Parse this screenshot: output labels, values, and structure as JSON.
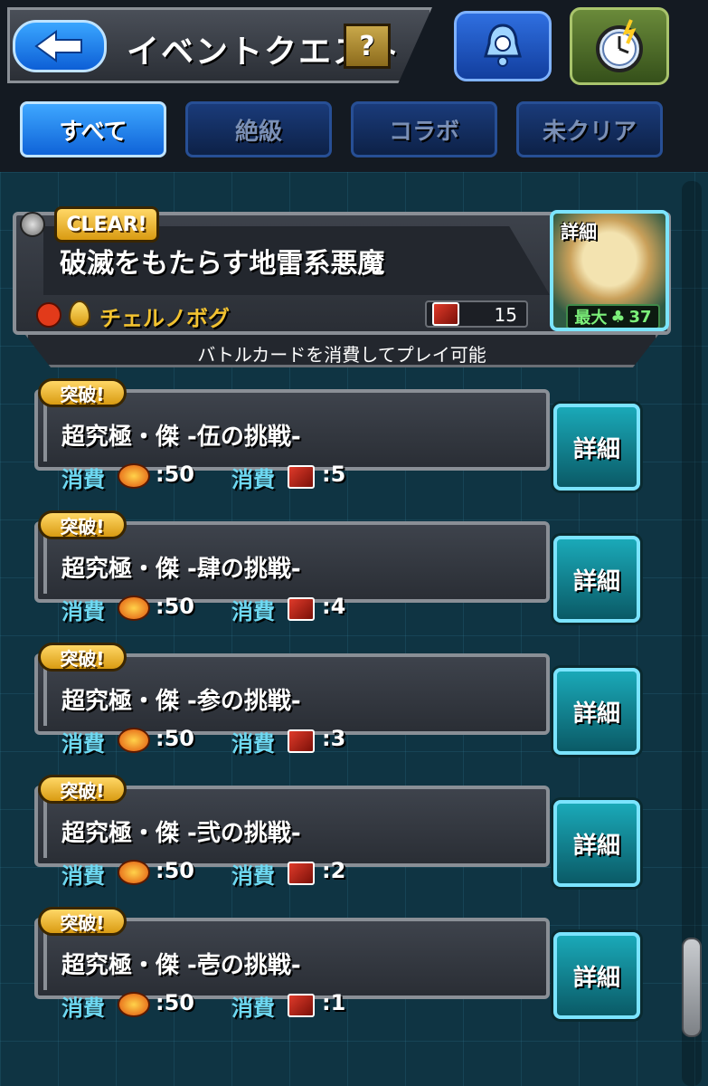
{
  "header": {
    "title": "イベントクエスト",
    "help_label": "?",
    "icons": [
      "back-arrow-icon",
      "bell-icon",
      "alarm-clock-icon"
    ]
  },
  "tabs": [
    {
      "label": "すべて",
      "active": true
    },
    {
      "label": "絶級",
      "active": false
    },
    {
      "label": "コラボ",
      "active": false
    },
    {
      "label": "未クリア",
      "active": false
    }
  ],
  "event": {
    "badge": "CLEAR!",
    "title": "破滅をもたらす地雷系悪魔",
    "boss_name": "チェルノボグ",
    "card_count": "15",
    "note": "バトルカードを消費してプレイ可能",
    "detail_label": "詳細",
    "max_label": "最大",
    "max_value": "37"
  },
  "quest_common": {
    "badge": "突破!",
    "cost_label": "消費",
    "stamina_value": ":50",
    "detail_label": "詳細"
  },
  "quests": [
    {
      "title": "超究極・傑 -伍の挑戦-",
      "card_cost": ":5"
    },
    {
      "title": "超究極・傑 -肆の挑戦-",
      "card_cost": ":4"
    },
    {
      "title": "超究極・傑 -参の挑戦-",
      "card_cost": ":3"
    },
    {
      "title": "超究極・傑 -弐の挑戦-",
      "card_cost": ":2"
    },
    {
      "title": "超究極・傑 -壱の挑戦-",
      "card_cost": ":1"
    }
  ],
  "colors": {
    "accent_blue": "#0f63d8",
    "cost_cyan": "#6ed9f2",
    "gold": "#f2c230",
    "detail_teal": "#1aa9b8"
  }
}
